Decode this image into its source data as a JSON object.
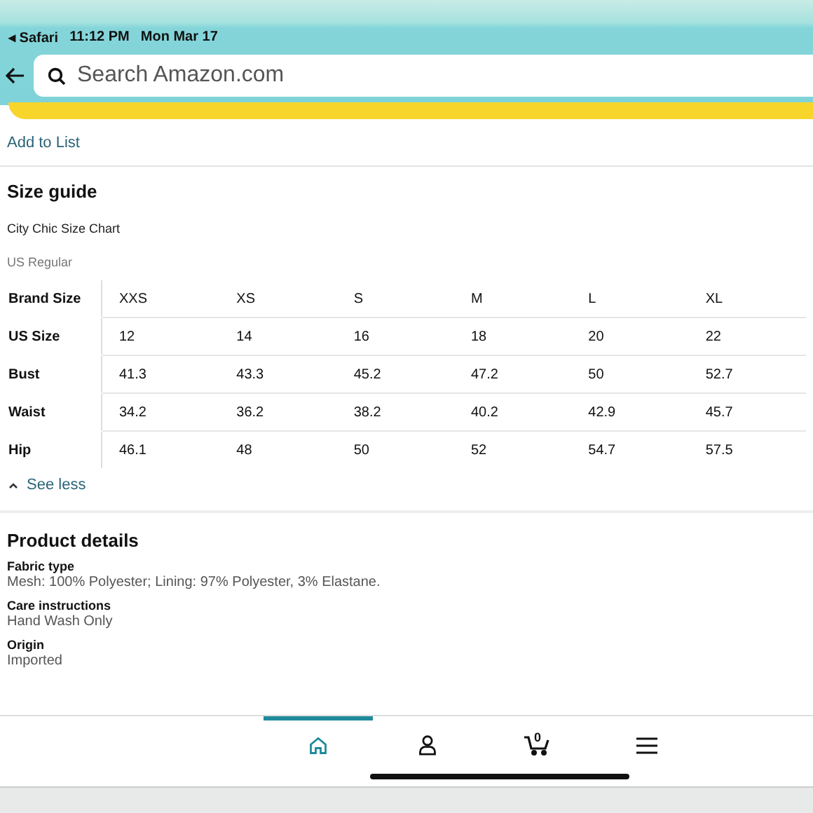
{
  "status_bar": {
    "back_app": "◂ Safari",
    "time": "11:12 PM",
    "date": "Mon Mar 17"
  },
  "search": {
    "placeholder": "Search Amazon.com"
  },
  "add_to_list": "Add to List",
  "size_guide": {
    "title": "Size guide",
    "chart_name": "City Chic Size Chart",
    "region": "US Regular",
    "rows": [
      {
        "label": "Brand Size",
        "values": [
          "XXS",
          "XS",
          "S",
          "M",
          "L",
          "XL"
        ]
      },
      {
        "label": "US Size",
        "values": [
          "12",
          "14",
          "16",
          "18",
          "20",
          "22"
        ]
      },
      {
        "label": "Bust",
        "values": [
          "41.3",
          "43.3",
          "45.2",
          "47.2",
          "50",
          "52.7"
        ]
      },
      {
        "label": "Waist",
        "values": [
          "34.2",
          "36.2",
          "38.2",
          "40.2",
          "42.9",
          "45.7"
        ]
      },
      {
        "label": "Hip",
        "values": [
          "46.1",
          "48",
          "50",
          "52",
          "54.7",
          "57.5"
        ]
      }
    ],
    "toggle": "See less"
  },
  "product_details": {
    "title": "Product details",
    "items": [
      {
        "label": "Fabric type",
        "value": "Mesh: 100% Polyester; Lining: 97% Polyester, 3% Elastane."
      },
      {
        "label": "Care instructions",
        "value": "Hand Wash Only"
      },
      {
        "label": "Origin",
        "value": "Imported"
      }
    ]
  },
  "nav": [
    {
      "kind": "home",
      "selected": true
    },
    {
      "kind": "account",
      "selected": false
    },
    {
      "kind": "cart",
      "count": "0",
      "selected": false
    },
    {
      "kind": "menu",
      "selected": false
    }
  ]
}
